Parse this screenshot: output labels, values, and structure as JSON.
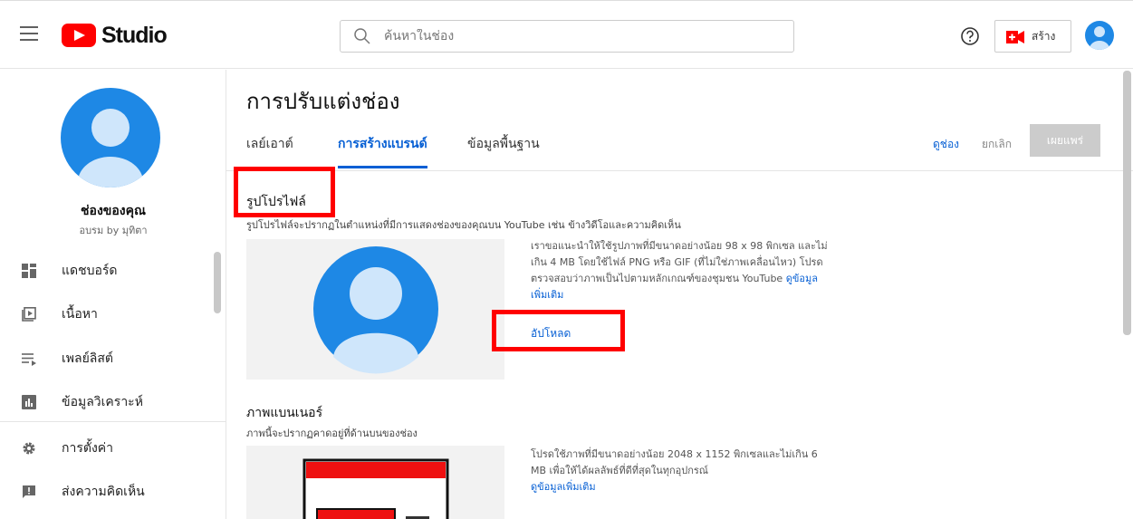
{
  "header": {
    "logo_text": "Studio",
    "search_placeholder": "ค้นหาในช่อง",
    "create_label": "สร้าง"
  },
  "sidebar": {
    "channel_name": "ช่องของคุณ",
    "channel_sub": "อบรม by มุทิตา",
    "items": [
      {
        "label": "แดชบอร์ด",
        "icon": "dashboard-icon"
      },
      {
        "label": "เนื้อหา",
        "icon": "content-icon"
      },
      {
        "label": "เพลย์ลิสต์",
        "icon": "playlist-icon"
      },
      {
        "label": "ข้อมูลวิเคราะห์",
        "icon": "analytics-icon"
      },
      {
        "label": "การตั้งค่า",
        "icon": "gear-icon"
      },
      {
        "label": "ส่งความคิดเห็น",
        "icon": "feedback-icon"
      }
    ]
  },
  "main": {
    "title": "การปรับแต่งช่อง",
    "tabs": [
      {
        "label": "เลย์เอาต์"
      },
      {
        "label": "การสร้างแบรนด์"
      },
      {
        "label": "ข้อมูลพื้นฐาน"
      }
    ],
    "actions": {
      "view": "ดูช่อง",
      "cancel": "ยกเลิก",
      "publish": "เผยแพร่"
    },
    "profile": {
      "title": "รูปโปรไฟล์",
      "desc": "รูปโปรไฟล์จะปรากฏในตำแหน่งที่มีการแสดงช่องของคุณบน YouTube เช่น ข้างวิดีโอและความคิดเห็น",
      "text": "เราขอแนะนำให้ใช้รูปภาพที่มีขนาดอย่างน้อย 98 x 98 พิกเซล และไม่เกิน 4 MB โดยใช้ไฟล์ PNG หรือ GIF (ที่ไม่ใช่ภาพเคลื่อนไหว) โปรดตรวจสอบว่าภาพเป็นไปตามหลักเกณฑ์ของชุมชน YouTube",
      "more_link": "ดูข้อมูลเพิ่มเติม",
      "upload": "อัปโหลด"
    },
    "banner": {
      "title": "ภาพแบนเนอร์",
      "desc": "ภาพนี้จะปรากฏคาดอยู่ที่ด้านบนของช่อง",
      "text": "โปรดใช้ภาพที่มีขนาดอย่างน้อย 2048 x 1152 พิกเซลและไม่เกิน 6 MB เพื่อให้ได้ผลลัพธ์ที่ดีที่สุดในทุกอุปกรณ์",
      "more_link": "ดูข้อมูลเพิ่มเติม"
    }
  },
  "colors": {
    "accent": "#065fd4",
    "brand_red": "#ff0000",
    "avatar_bg": "#1e88e5",
    "avatar_fg": "#cfe6fb",
    "highlight": "#ff0000"
  }
}
